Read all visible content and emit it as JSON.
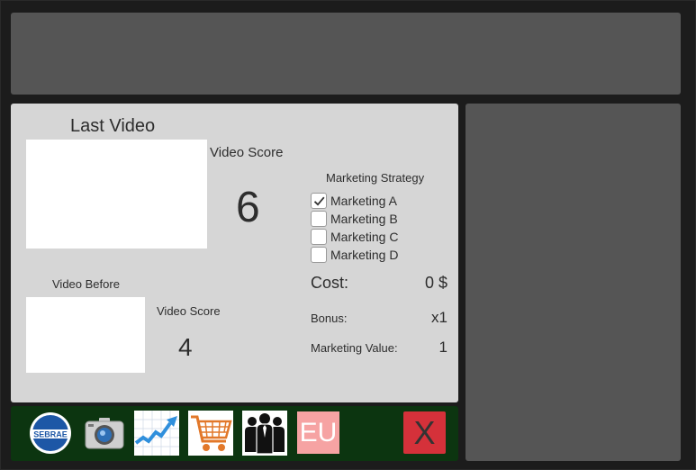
{
  "last_video": {
    "title": "Last Video",
    "score_label": "Video Score",
    "score": "6"
  },
  "video_before": {
    "title": "Video Before",
    "score_label": "Video Score",
    "score": "4"
  },
  "marketing": {
    "title": "Marketing Strategy",
    "options": [
      {
        "label": "Marketing A",
        "checked": true
      },
      {
        "label": "Marketing B",
        "checked": false
      },
      {
        "label": "Marketing C",
        "checked": false
      },
      {
        "label": "Marketing D",
        "checked": false
      }
    ]
  },
  "stats": {
    "cost_label": "Cost:",
    "cost_value": "0 $",
    "bonus_label": "Bonus:",
    "bonus_value": "x1",
    "marketing_value_label": "Marketing Value:",
    "marketing_value": "1"
  },
  "toolbar": {
    "sebrae_text": "SEBRAE",
    "eu_label": "EU",
    "close_label": "X",
    "icons": [
      "sebrae-logo-icon",
      "camera-icon",
      "growth-chart-icon",
      "shopping-cart-icon",
      "team-icon"
    ]
  },
  "colors": {
    "panel_bg": "#d6d6d6",
    "dark_panel": "#555555",
    "toolbar_bg": "#0c3510",
    "eu_bg": "#f6a3a3",
    "close_bg": "#d5313a"
  }
}
